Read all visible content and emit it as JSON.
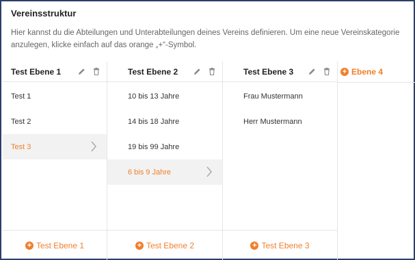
{
  "title": "Vereinsstruktur",
  "description": {
    "line1": "Hier kannst du die Abteilungen und Unterabteilungen deines Vereins definieren. Um eine neue Vereinskategorie",
    "line2": "anzulegen, klicke einfach auf das orange „+“-Symbol."
  },
  "columns": [
    {
      "title": "Test Ebene 1",
      "items": [
        "Test 1",
        "Test 2",
        "Test 3"
      ],
      "selected_index": 2,
      "add_label": "Test Ebene 1"
    },
    {
      "title": "Test Ebene 2",
      "items": [
        "10 bis 13 Jahre",
        "14 bis 18 Jahre",
        "19 bis 99 Jahre",
        "6 bis 9 Jahre"
      ],
      "selected_index": 3,
      "add_label": "Test Ebene 2"
    },
    {
      "title": "Test Ebene 3",
      "items": [
        "Frau Mustermann",
        "Herr Mustermann"
      ],
      "selected_index": -1,
      "add_label": "Test Ebene 3"
    }
  ],
  "add_level": {
    "label": "Ebene 4"
  },
  "icons": {
    "edit": "pencil-icon",
    "delete": "trash-icon",
    "add": "plus-circle-icon",
    "chevron": "chevron-right-icon"
  },
  "colors": {
    "accent": "#f07f2b",
    "selected_bg": "#f2f2f2",
    "border": "#2c3e6b"
  }
}
